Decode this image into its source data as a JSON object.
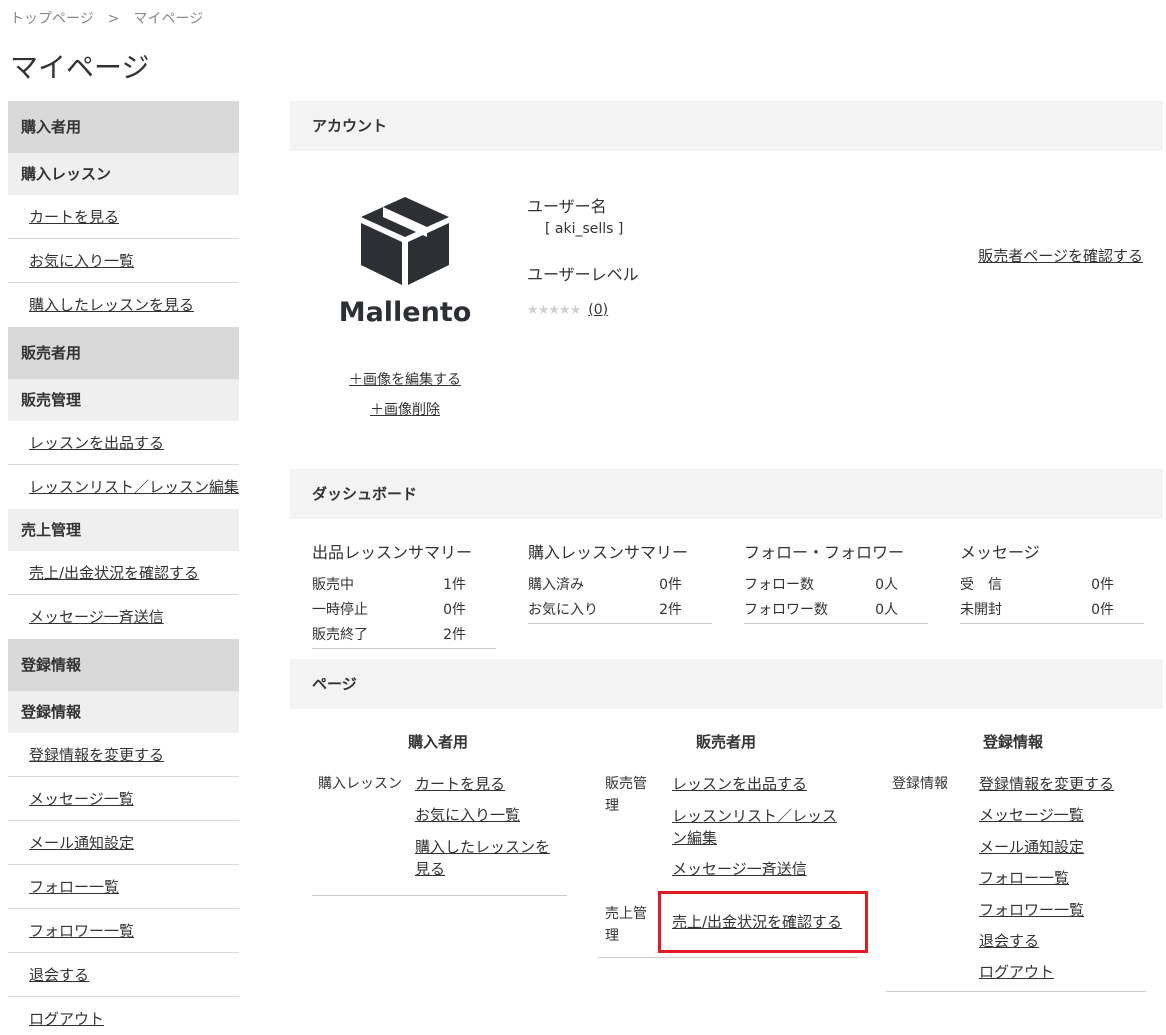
{
  "breadcrumb": {
    "home": "トップページ",
    "separator": ">",
    "current": "マイページ"
  },
  "page_title": "マイページ",
  "sidebar": {
    "buyer": {
      "title": "購入者用",
      "group": "購入レッスン",
      "items": [
        "カートを見る",
        "お気に入り一覧",
        "購入したレッスンを見る"
      ]
    },
    "seller": {
      "title": "販売者用",
      "group1": "販売管理",
      "items1": [
        "レッスンを出品する",
        "レッスンリスト／レッスン編集"
      ],
      "group2": "売上管理",
      "items2": [
        "売上/出金状況を確認する",
        "メッセージ一斉送信"
      ]
    },
    "registration": {
      "title": "登録情報",
      "group": "登録情報",
      "items": [
        "登録情報を変更する",
        "メッセージ一覧",
        "メール通知設定",
        "フォロー一覧",
        "フォロワー一覧",
        "退会する",
        "ログアウト"
      ]
    }
  },
  "account": {
    "heading": "アカウント",
    "logo_text": "Mallento",
    "edit_image": "＋画像を編集する",
    "delete_image": "＋画像削除",
    "username_label": "ユーザー名",
    "username": "[ aki_sells ]",
    "level_label": "ユーザーレベル",
    "stars": "★★★★★",
    "rating_count": "(0)",
    "seller_page_link": "販売者ページを確認する"
  },
  "dashboard": {
    "heading": "ダッシュボード",
    "listed": {
      "title": "出品レッスンサマリー",
      "rows": [
        [
          "販売中",
          "1件"
        ],
        [
          "一時停止",
          "0件"
        ],
        [
          "販売終了",
          "2件"
        ]
      ]
    },
    "purchased": {
      "title": "購入レッスンサマリー",
      "rows": [
        [
          "購入済み",
          "0件"
        ],
        [
          "お気に入り",
          "2件"
        ]
      ]
    },
    "follow": {
      "title": "フォロー・フォロワー",
      "rows": [
        [
          "フォロー数",
          "0人"
        ],
        [
          "フォロワー数",
          "0人"
        ]
      ]
    },
    "messages": {
      "title": "メッセージ",
      "rows": [
        [
          "受　信",
          "0件"
        ],
        [
          "未開封",
          "0件"
        ]
      ]
    }
  },
  "pages": {
    "heading": "ページ",
    "buyer": {
      "title": "購入者用",
      "group": "購入レッスン",
      "links": [
        "カートを見る",
        "お気に入り一覧",
        "購入したレッスンを見る"
      ]
    },
    "seller": {
      "title": "販売者用",
      "group1": "販売管理",
      "links1": [
        "レッスンを出品する",
        "レッスンリスト／レッスン編集",
        "メッセージ一斉送信"
      ],
      "group2": "売上管理",
      "links2": [
        "売上/出金状況を確認する"
      ]
    },
    "registration": {
      "title": "登録情報",
      "group": "登録情報",
      "links": [
        "登録情報を変更する",
        "メッセージ一覧",
        "メール通知設定",
        "フォロー一覧",
        "フォロワー一覧",
        "退会する",
        "ログアウト"
      ]
    }
  },
  "colors": {
    "highlight": "#e01b24",
    "section_bg": "#d9d9d9",
    "group_bg": "#efefef",
    "panel_head_bg": "#f3f3f3"
  }
}
